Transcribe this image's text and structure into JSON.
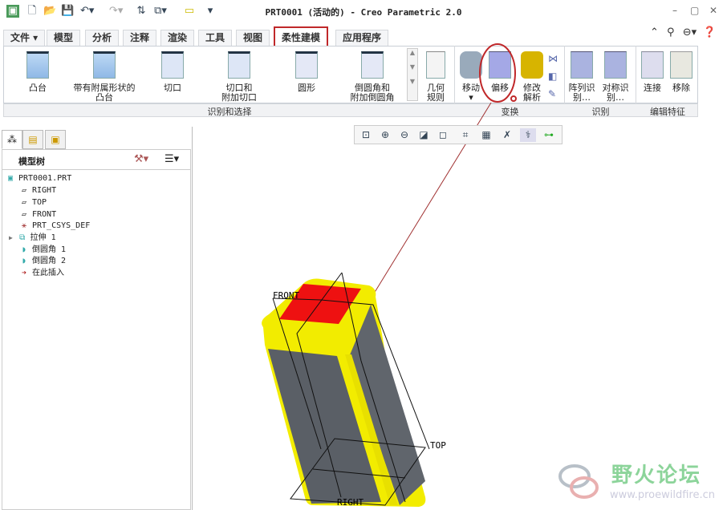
{
  "window": {
    "title": "PRT0001 (活动的) - Creo Parametric 2.0"
  },
  "quick_access": [
    "app-icon",
    "new-icon",
    "open-icon",
    "save-icon",
    "undo-icon",
    "redo-icon",
    "regenerate-icon",
    "windows-icon",
    "close-window-icon",
    "customize-icon"
  ],
  "tabs": [
    {
      "label": "文件 ▾"
    },
    {
      "label": "模型"
    },
    {
      "label": "分析"
    },
    {
      "label": "注释"
    },
    {
      "label": "渲染"
    },
    {
      "label": "工具"
    },
    {
      "label": "视图"
    },
    {
      "label": "柔性建模",
      "active": true
    },
    {
      "label": "应用程序"
    }
  ],
  "ribbon": {
    "gallery": [
      {
        "label": "凸台"
      },
      {
        "label": "带有附属形状的\n凸台"
      },
      {
        "label": "切口"
      },
      {
        "label": "切口和\n附加切口"
      },
      {
        "label": "圆形"
      },
      {
        "label": "倒圆角和\n附加倒圆角"
      }
    ],
    "geometry_rules": "几何\n规则",
    "move": "移动",
    "offset": "偏移",
    "modify_analytic": "修改\n解析",
    "pattern_recognize": "阵列识\n别…",
    "symmetry_recognize": "对称识\n别…",
    "attach": "连接",
    "remove": "移除",
    "groups": {
      "shape_surface": "识别和选择",
      "transform": "变换",
      "recognize": "识别",
      "edit_feature": "编辑特征"
    }
  },
  "model_tree": {
    "header": "模型树",
    "items": [
      {
        "label": "PRT0001.PRT",
        "icon": "part-icon"
      },
      {
        "label": "RIGHT",
        "icon": "datum-plane-icon"
      },
      {
        "label": "TOP",
        "icon": "datum-plane-icon"
      },
      {
        "label": "FRONT",
        "icon": "datum-plane-icon"
      },
      {
        "label": "PRT_CSYS_DEF",
        "icon": "csys-icon"
      },
      {
        "label": "拉伸 1",
        "icon": "extrude-icon"
      },
      {
        "label": "倒圆角 1",
        "icon": "round-icon"
      },
      {
        "label": "倒圆角 2",
        "icon": "round-icon"
      },
      {
        "label": "在此插入",
        "icon": "insert-here-icon"
      }
    ]
  },
  "viewport": {
    "labels": {
      "front": "FRONT",
      "top": "TOP",
      "right": "RIGHT"
    }
  },
  "watermark": {
    "name": "野火论坛",
    "url": "www.proewildfire.cn"
  },
  "colors": {
    "highlight": "#c0282a",
    "model_yellow": "#f2ec00",
    "model_gray": "#5a5f66",
    "selected_face": "#ee1111"
  }
}
